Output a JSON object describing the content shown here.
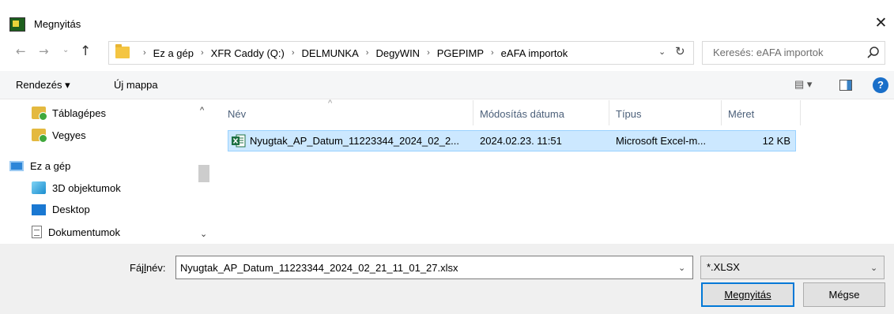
{
  "window": {
    "title": "Megnyitás",
    "close_glyph": "✕"
  },
  "address": {
    "crumbs": [
      "Ez a gép",
      "XFR Caddy (Q:)",
      "DELMUNKA",
      "DegyWIN",
      "PGEPIMP",
      "eAFA importok"
    ],
    "separator": "›",
    "search_placeholder": "Keresés: eAFA importok"
  },
  "toolbar": {
    "organize_label": "Rendezés ▾",
    "new_folder_label": "Új mappa",
    "view_label": "▤ ▾",
    "help_label": "?"
  },
  "nav": {
    "items": [
      {
        "label": "Táblagépes",
        "icon": "quick-access-folder-icon"
      },
      {
        "label": "Vegyes",
        "icon": "quick-access-folder-icon"
      },
      {
        "label": "Ez a gép",
        "icon": "this-pc-icon"
      },
      {
        "label": "3D objektumok",
        "icon": "3d-objects-icon"
      },
      {
        "label": "Desktop",
        "icon": "desktop-icon"
      },
      {
        "label": "Dokumentumok",
        "icon": "documents-icon"
      }
    ]
  },
  "columns": {
    "name": "Név",
    "modified": "Módosítás dátuma",
    "type": "Típus",
    "size": "Méret"
  },
  "files": [
    {
      "name": "Nyugtak_AP_Datum_11223344_2024_02_2...",
      "modified": "2024.02.23. 11:51",
      "type": "Microsoft Excel-m...",
      "size": "12 KB",
      "selected": true
    }
  ],
  "bottom": {
    "filename_label_pre": "Fáj",
    "filename_label_ul": "l",
    "filename_label_post": "név:",
    "filename_value": "Nyugtak_AP_Datum_11223344_2024_02_21_11_01_27.xlsx",
    "filter_value": "*.XLSX",
    "open_label": "Megnyitás",
    "cancel_label": "Mégse"
  },
  "colors": {
    "accent": "#0078d7",
    "selection": "#cce8ff",
    "help": "#1a6fc9"
  }
}
